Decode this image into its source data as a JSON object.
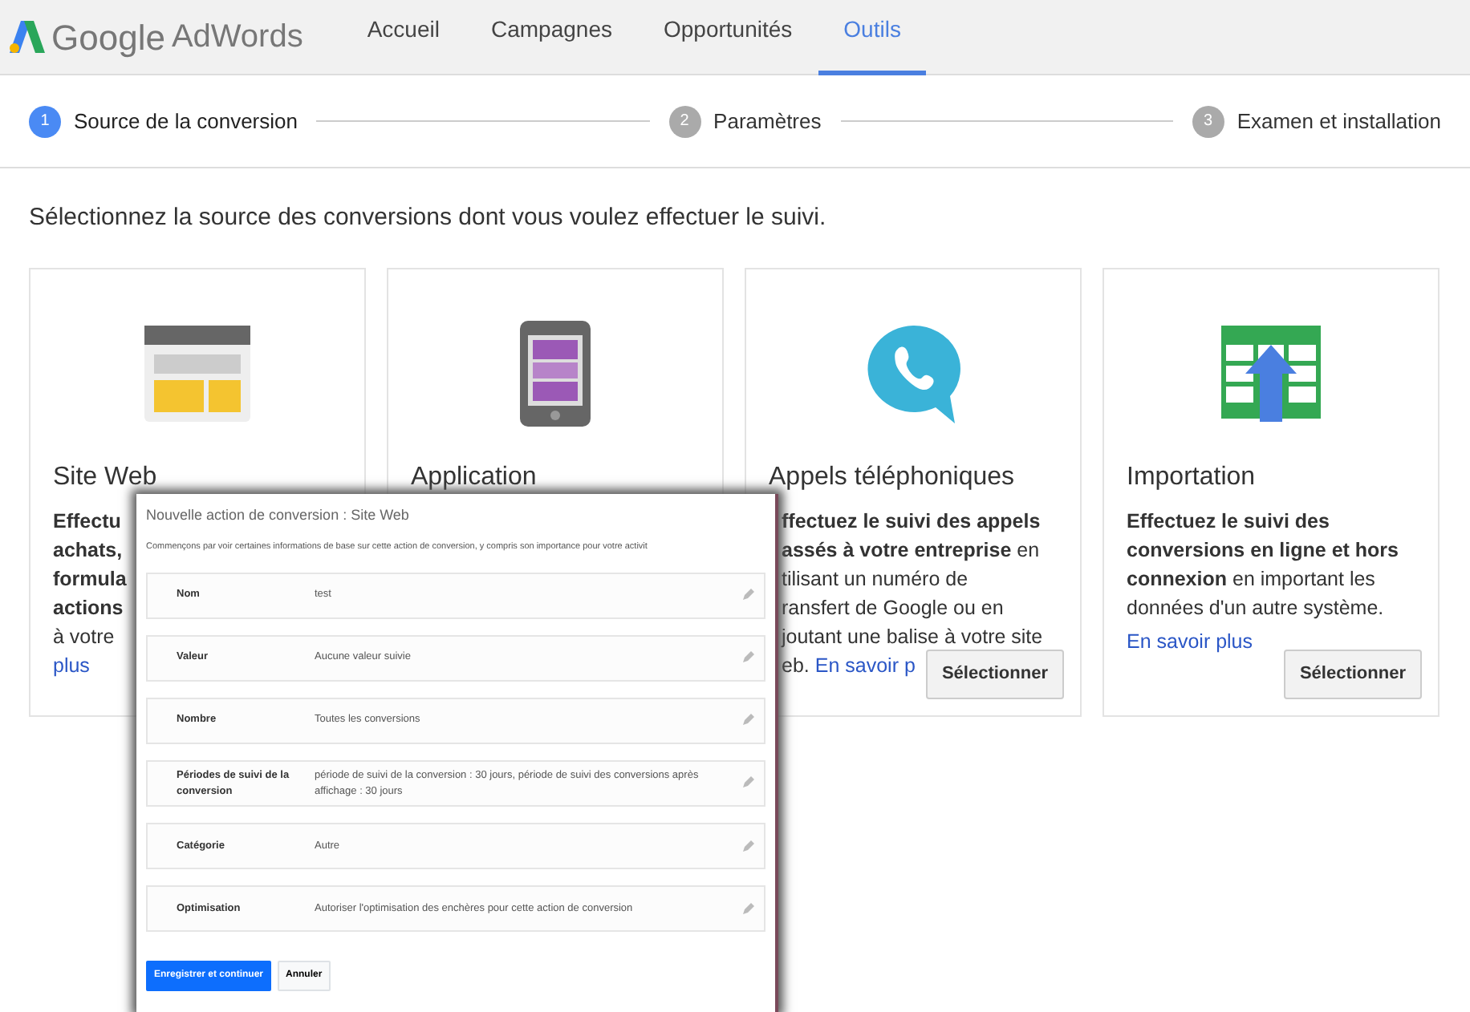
{
  "header": {
    "logo": {
      "brand": "Google",
      "product": "AdWords"
    },
    "nav": [
      {
        "label": "Accueil",
        "selected": false
      },
      {
        "label": "Campagnes",
        "selected": false
      },
      {
        "label": "Opportunités",
        "selected": false
      },
      {
        "label": "Outils",
        "selected": true
      }
    ]
  },
  "steps": [
    {
      "number": "1",
      "label": "Source de la conversion",
      "selected": true
    },
    {
      "number": "2",
      "label": "Paramètres",
      "selected": false
    },
    {
      "number": "3",
      "label": "Examen et installation",
      "selected": false
    }
  ],
  "intro": "Sélectionnez la source des conversions dont vous voulez effectuer le suivi.",
  "cards": [
    {
      "title": "Site Web",
      "kind": "partial",
      "lines": [
        {
          "text": "**Effectu**"
        },
        {
          "text": "**achats,**"
        },
        {
          "text": "**formula**"
        },
        {
          "text": "**actions**"
        },
        {
          "text": "à votre"
        },
        {
          "link": "plus"
        }
      ]
    },
    {
      "title": "Application",
      "kind": "partial"
    },
    {
      "title": "Appels téléphoniques",
      "kind": "partial",
      "lines": [
        {
          "text": "**ffectuez le suivi des appels**"
        },
        {
          "text": "**assés à votre entreprise** en"
        },
        {
          "text": "tilisant un numéro de"
        },
        {
          "text": "ransfert de Google ou en"
        },
        {
          "text": "joutant une balise à votre site"
        },
        {
          "text": "eb.",
          "link": "En savoir p"
        }
      ],
      "button": "Sélectionner"
    },
    {
      "title": "Importation",
      "kind": "full",
      "description": "**Effectuez le suivi des conversions en ligne et hors connexion** en important les données d'un autre système.",
      "link": "En savoir plus",
      "button": "Sélectionner"
    }
  ],
  "dialog": {
    "title": "Nouvelle action de conversion : Site Web",
    "subtitle": "Commençons par voir certaines informations de base sur cette action de conversion, y compris son importance pour votre activit",
    "fields": [
      {
        "label": "Nom",
        "value": "test"
      },
      {
        "label": "Valeur",
        "value": "Aucune valeur suivie"
      },
      {
        "label": "Nombre",
        "value": "Toutes les conversions"
      },
      {
        "label": "Périodes de suivi de la conversion",
        "value": "période de suivi de la conversion : 30 jours, période de suivi des conversions après affichage : 30 jours"
      },
      {
        "label": "Catégorie",
        "value": "Autre"
      },
      {
        "label": "Optimisation",
        "value": "Autoriser l'optimisation des enchères pour cette action de conversion"
      }
    ],
    "buttons": [
      {
        "label": "Enregistrer et continuer",
        "kind": "primary"
      },
      {
        "label": "Annuler",
        "kind": "secondary"
      }
    ]
  }
}
